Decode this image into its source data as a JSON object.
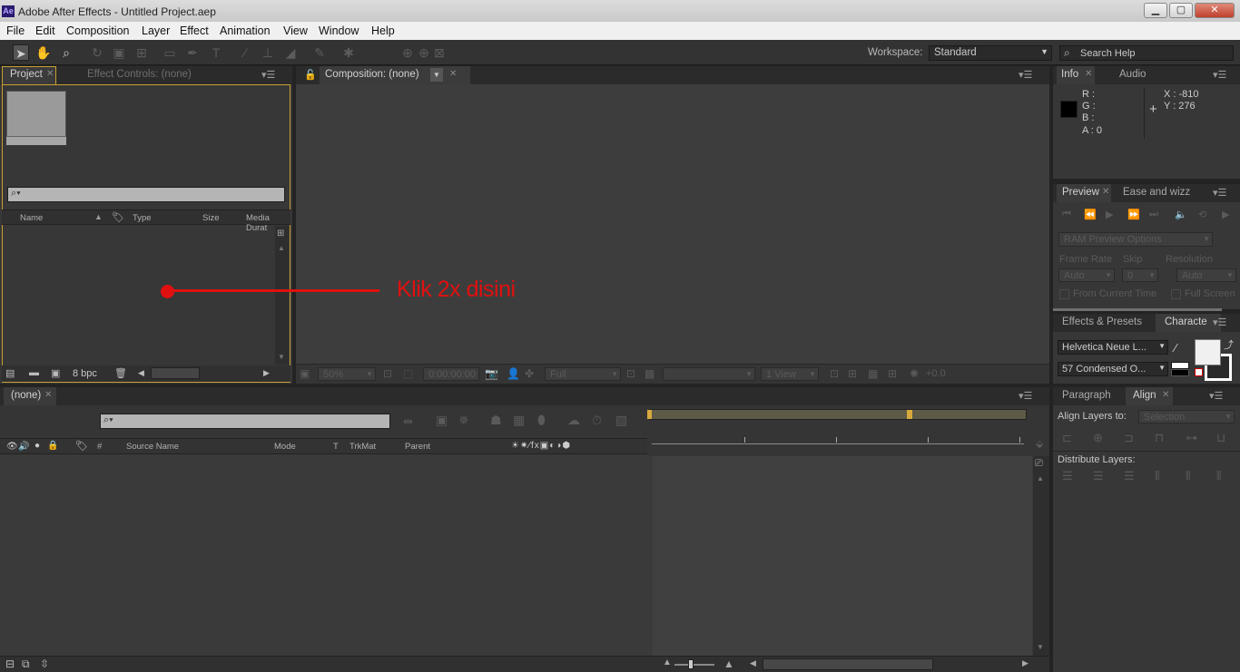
{
  "window": {
    "app_icon": "Ae",
    "title": "Adobe After Effects - Untitled Project.aep",
    "minimize": "▁",
    "maximize": "▢",
    "close": "✕"
  },
  "menu": [
    "File",
    "Edit",
    "Composition",
    "Layer",
    "Effect",
    "Animation",
    "View",
    "Window",
    "Help"
  ],
  "toolbar": {
    "workspace_label": "Workspace:",
    "workspace_value": "Standard",
    "search_placeholder": "Search Help"
  },
  "project": {
    "tab_project": "Project",
    "tab_effect_controls": "Effect Controls: (none)",
    "columns": [
      "Name",
      "Type",
      "Size",
      "Media Durat"
    ],
    "bpc": "8 bpc"
  },
  "composition": {
    "tab": "Composition: (none)",
    "zoom": "50%",
    "timecode": "0:00:00:00",
    "resolution": "Full",
    "views": "1 View",
    "exposure": "+0.0"
  },
  "annotation": {
    "text": "Klik 2x disini",
    "color": "#e01010"
  },
  "info": {
    "tab_info": "Info",
    "tab_audio": "Audio",
    "r": "R :",
    "g": "G :",
    "b": "B :",
    "a": "A : 0",
    "x": "X : -810",
    "y": "Y : 276"
  },
  "preview": {
    "tab_preview": "Preview",
    "tab_ease": "Ease and wizz",
    "ram_options": "RAM Preview Options",
    "frame_rate_label": "Frame Rate",
    "skip_label": "Skip",
    "resolution_label": "Resolution",
    "frame_rate_value": "Auto",
    "skip_value": "0",
    "resolution_value": "Auto",
    "from_current": "From Current Time",
    "full_screen": "Full Screen"
  },
  "character": {
    "tab_effects": "Effects & Presets",
    "tab_character": "Characte",
    "font": "Helvetica Neue L...",
    "style": "57 Condensed O..."
  },
  "timeline": {
    "tab": "(none)",
    "columns": [
      "#",
      "Source Name",
      "Mode",
      "T",
      "TrkMat",
      "Parent"
    ]
  },
  "align": {
    "tab_paragraph": "Paragraph",
    "tab_align": "Align",
    "align_label": "Align Layers to:",
    "align_value": "Selection",
    "distribute_label": "Distribute Layers:"
  }
}
